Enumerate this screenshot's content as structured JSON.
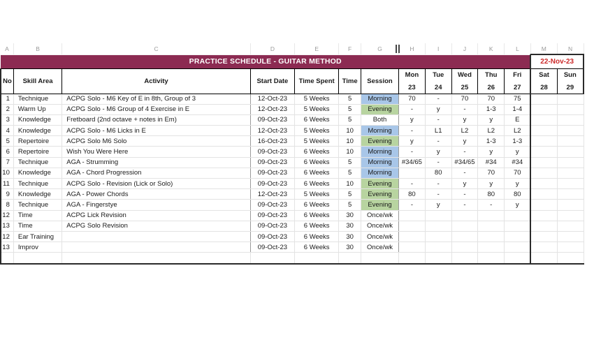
{
  "app": {
    "type": "spreadsheet",
    "accent_maroon": "#8c2b52",
    "date_red": "#cc2b2b",
    "morning_fill": "#a8c6e8",
    "evening_fill": "#b8d4a0"
  },
  "column_letters": [
    "A",
    "B",
    "C",
    "D",
    "E",
    "F",
    "G",
    "H",
    "I",
    "J",
    "K",
    "L",
    "M",
    "N"
  ],
  "freeze_handle": {
    "name": "freeze-pane-handle",
    "after_column": "G"
  },
  "title": {
    "text": "PRACTICE SCHEDULE - GUITAR METHOD",
    "date": "22-Nov-23"
  },
  "headers": {
    "row1": [
      "No",
      "Skill Area",
      "Activity",
      "Start Date",
      "Time Spent",
      "Time",
      "Session",
      "Mon",
      "Tue",
      "Wed",
      "Thu",
      "Fri",
      "Sat",
      "Sun"
    ],
    "day_numbers": [
      "23",
      "24",
      "25",
      "26",
      "27",
      "28",
      "29"
    ]
  },
  "rows": [
    {
      "no": "1",
      "skill": "Technique",
      "activity": "ACPG Solo - M6 Key of E in 8th, Group of 3",
      "start": "12-Oct-23",
      "spent": "5 Weeks",
      "time": "5",
      "session": "Morning",
      "session_fill": "morning",
      "days": [
        "70",
        "-",
        "70",
        "70",
        "75",
        "",
        ""
      ]
    },
    {
      "no": "2",
      "skill": "Warm Up",
      "activity": "ACPG Solo - M6 Group of 4 Exercise in E",
      "start": "12-Oct-23",
      "spent": "5 Weeks",
      "time": "5",
      "session": "Evening",
      "session_fill": "evening",
      "days": [
        "-",
        "y",
        "-",
        "1-3",
        "1-4",
        "",
        ""
      ]
    },
    {
      "no": "3",
      "skill": "Knowledge",
      "activity": "Fretboard (2nd octave + notes in Em)",
      "start": "09-Oct-23",
      "spent": "6 Weeks",
      "time": "5",
      "session": "Both",
      "session_fill": "none",
      "days": [
        "y",
        "-",
        "y",
        "y",
        "E",
        "",
        ""
      ]
    },
    {
      "no": "4",
      "skill": "Knowledge",
      "activity": "ACPG Solo - M6 Licks in E",
      "start": "12-Oct-23",
      "spent": "5 Weeks",
      "time": "10",
      "session": "Morning",
      "session_fill": "morning",
      "days": [
        "-",
        "L1",
        "L2",
        "L2",
        "L2",
        "",
        ""
      ]
    },
    {
      "no": "5",
      "skill": "Repertoire",
      "activity": "ACPG Solo M6 Solo",
      "start": "16-Oct-23",
      "spent": "5 Weeks",
      "time": "10",
      "session": "Evening",
      "session_fill": "evening",
      "days": [
        "y",
        "-",
        "y",
        "1-3",
        "1-3",
        "",
        ""
      ]
    },
    {
      "no": "6",
      "skill": "Repertoire",
      "activity": "Wish You Were Here",
      "start": "09-Oct-23",
      "spent": "6 Weeks",
      "time": "10",
      "session": "Morning",
      "session_fill": "morning",
      "days": [
        "-",
        "y",
        "-",
        "y",
        "y",
        "",
        ""
      ]
    },
    {
      "no": "7",
      "skill": "Technique",
      "activity": "AGA - Strumming",
      "start": "09-Oct-23",
      "spent": "6 Weeks",
      "time": "5",
      "session": "Morning",
      "session_fill": "morning",
      "days": [
        "#34/65",
        "-",
        "#34/65",
        "#34",
        "#34",
        "",
        ""
      ]
    },
    {
      "no": "10",
      "skill": "Knowledge",
      "activity": "AGA - Chord Progression",
      "start": "09-Oct-23",
      "spent": "6 Weeks",
      "time": "5",
      "session": "Morning",
      "session_fill": "morning",
      "days": [
        "",
        "80",
        "-",
        "70",
        "70",
        "",
        ""
      ]
    },
    {
      "no": "11",
      "skill": "Technique",
      "activity": "ACPG Solo - Revision (Lick or Solo)",
      "start": "09-Oct-23",
      "spent": "6 Weeks",
      "time": "10",
      "session": "Evening",
      "session_fill": "evening",
      "days": [
        "-",
        "-",
        "y",
        "y",
        "y",
        "",
        ""
      ]
    },
    {
      "no": "9",
      "skill": "Knowledge",
      "activity": "AGA - Power Chords",
      "start": "12-Oct-23",
      "spent": "5 Weeks",
      "time": "5",
      "session": "Evening",
      "session_fill": "evening",
      "days": [
        "80",
        "-",
        "-",
        "80",
        "80",
        "",
        ""
      ]
    },
    {
      "no": "8",
      "skill": "Technique",
      "activity": "AGA - Fingerstye",
      "start": "09-Oct-23",
      "spent": "6 Weeks",
      "time": "5",
      "session": "Evening",
      "session_fill": "evening",
      "days": [
        "-",
        "y",
        "-",
        "-",
        "y",
        "",
        ""
      ]
    },
    {
      "no": "12",
      "skill": "Time",
      "activity": "ACPG Lick Revision",
      "start": "09-Oct-23",
      "spent": "6 Weeks",
      "time": "30",
      "session": "Once/wk",
      "session_fill": "none",
      "days": [
        "",
        "",
        "",
        "",
        "",
        "",
        ""
      ]
    },
    {
      "no": "13",
      "skill": "Time",
      "activity": "ACPG Solo Revision",
      "start": "09-Oct-23",
      "spent": "6 Weeks",
      "time": "30",
      "session": "Once/wk",
      "session_fill": "none",
      "days": [
        "",
        "",
        "",
        "",
        "",
        "",
        ""
      ]
    },
    {
      "no": "12",
      "skill": "Ear Training",
      "activity": "",
      "start": "09-Oct-23",
      "spent": "6 Weeks",
      "time": "30",
      "session": "Once/wk",
      "session_fill": "none",
      "days": [
        "",
        "",
        "",
        "",
        "",
        "",
        ""
      ]
    },
    {
      "no": "13",
      "skill": "Improv",
      "activity": "",
      "start": "09-Oct-23",
      "spent": "6 Weeks",
      "time": "30",
      "session": "Once/wk",
      "session_fill": "none",
      "days": [
        "",
        "",
        "",
        "",
        "",
        "",
        ""
      ]
    }
  ]
}
